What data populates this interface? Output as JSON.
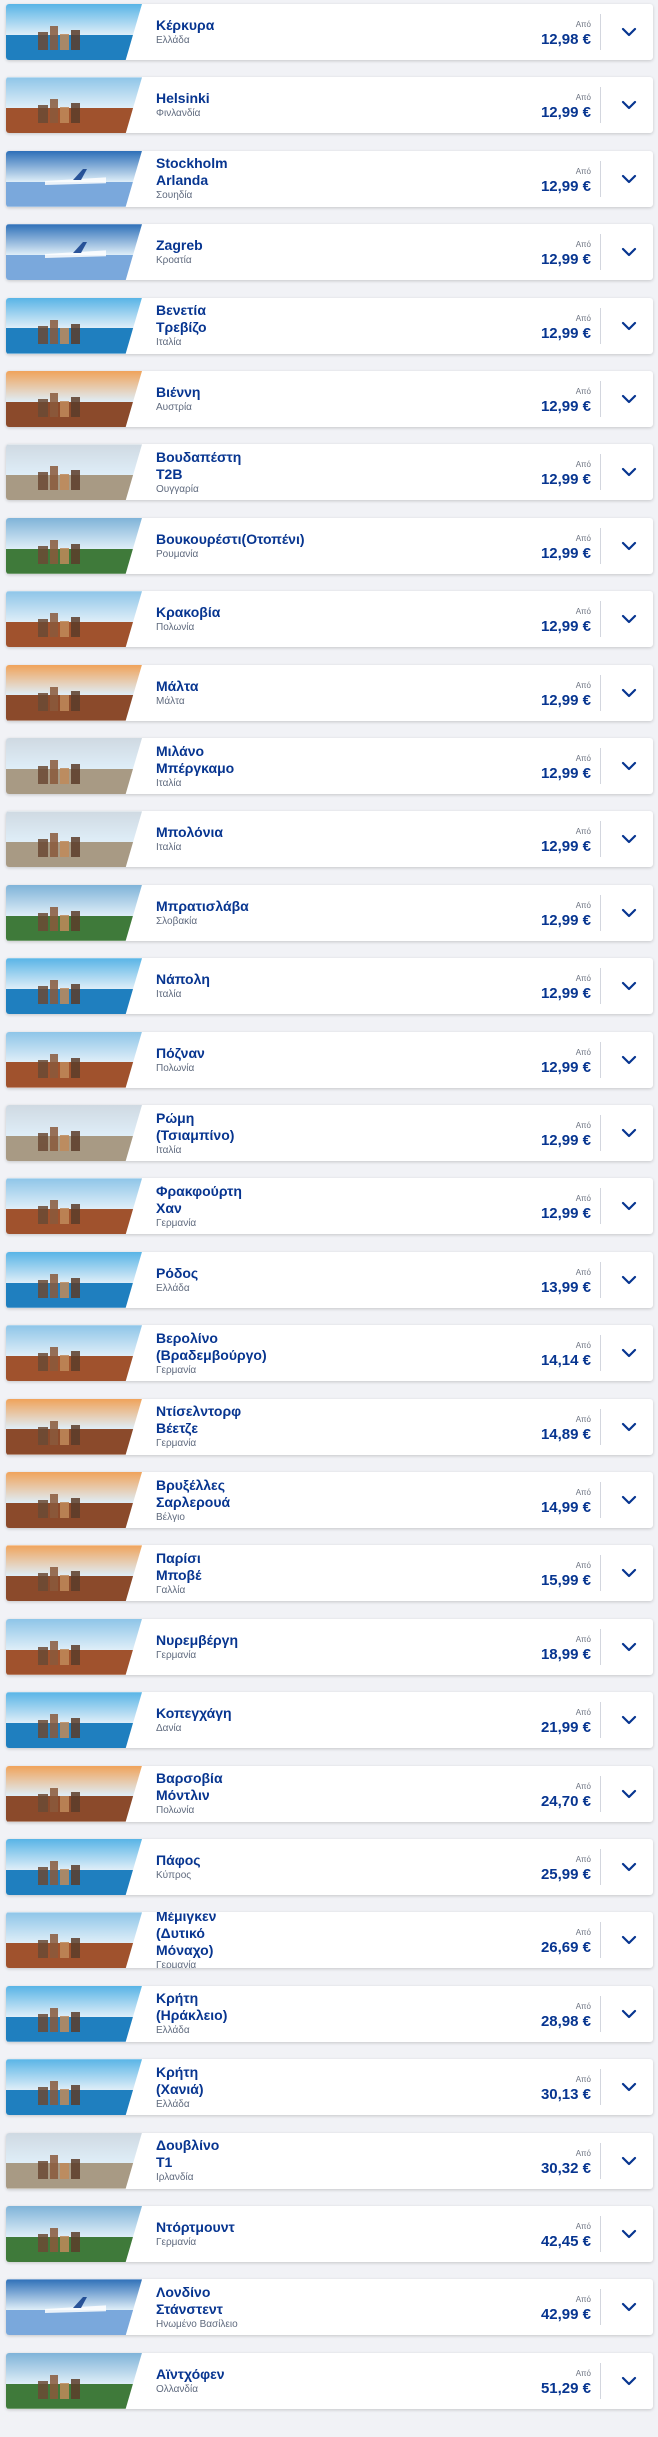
{
  "from_label": "Από",
  "destinations": [
    {
      "city": "Κέρκυρα",
      "country": "Ελλάδα",
      "price": "12,98 €",
      "theme": "sea"
    },
    {
      "city": "Helsinki",
      "country": "Φινλανδία",
      "price": "12,99 €",
      "theme": "city"
    },
    {
      "city": "Stockholm\nArlanda",
      "country": "Σουηδία",
      "price": "12,99 €",
      "theme": "plane"
    },
    {
      "city": "Zagreb",
      "country": "Κροατία",
      "price": "12,99 €",
      "theme": "plane"
    },
    {
      "city": "Βενετία\nΤρεβίζο",
      "country": "Ιταλία",
      "price": "12,99 €",
      "theme": "sea"
    },
    {
      "city": "Βιέννη",
      "country": "Αυστρία",
      "price": "12,99 €",
      "theme": "sunset"
    },
    {
      "city": "Βουδαπέστη\nT2B",
      "country": "Ουγγαρία",
      "price": "12,99 €",
      "theme": "stone"
    },
    {
      "city": "Βουκουρέστι(Οτοπένι)",
      "country": "Ρουμανία",
      "price": "12,99 €",
      "theme": "green"
    },
    {
      "city": "Κρακοβία",
      "country": "Πολωνία",
      "price": "12,99 €",
      "theme": "city"
    },
    {
      "city": "Μάλτα",
      "country": "Μάλτα",
      "price": "12,99 €",
      "theme": "sunset"
    },
    {
      "city": "Μιλάνο\nΜπέργκαμο",
      "country": "Ιταλία",
      "price": "12,99 €",
      "theme": "stone"
    },
    {
      "city": "Μπολόνια",
      "country": "Ιταλία",
      "price": "12,99 €",
      "theme": "stone"
    },
    {
      "city": "Μπρατισλάβα",
      "country": "Σλοβακία",
      "price": "12,99 €",
      "theme": "green"
    },
    {
      "city": "Νάπολη",
      "country": "Ιταλία",
      "price": "12,99 €",
      "theme": "sea"
    },
    {
      "city": "Πόζναν",
      "country": "Πολωνία",
      "price": "12,99 €",
      "theme": "city"
    },
    {
      "city": "Ρώμη\n(Τσιαμπίνο)",
      "country": "Ιταλία",
      "price": "12,99 €",
      "theme": "stone"
    },
    {
      "city": "Φρακφούρτη\nΧαν",
      "country": "Γερμανία",
      "price": "12,99 €",
      "theme": "city"
    },
    {
      "city": "Ρόδος",
      "country": "Ελλάδα",
      "price": "13,99 €",
      "theme": "sea"
    },
    {
      "city": "Βερολίνο\n(Βραδεμβούργο)",
      "country": "Γερμανία",
      "price": "14,14 €",
      "theme": "city"
    },
    {
      "city": "Ντίσελντορφ\nΒέετζε",
      "country": "Γερμανία",
      "price": "14,89 €",
      "theme": "sunset"
    },
    {
      "city": "Βρυξέλλες\nΣαρλερουά",
      "country": "Βέλγιο",
      "price": "14,99 €",
      "theme": "sunset"
    },
    {
      "city": "Παρίσι\nΜποβέ",
      "country": "Γαλλία",
      "price": "15,99 €",
      "theme": "sunset"
    },
    {
      "city": "Νυρεμβέργη",
      "country": "Γερμανία",
      "price": "18,99 €",
      "theme": "city"
    },
    {
      "city": "Κοπεγχάγη",
      "country": "Δανία",
      "price": "21,99 €",
      "theme": "sea"
    },
    {
      "city": "Βαρσοβία\nΜόντλιν",
      "country": "Πολωνία",
      "price": "24,70 €",
      "theme": "sunset"
    },
    {
      "city": "Πάφος",
      "country": "Κύπρος",
      "price": "25,99 €",
      "theme": "sea"
    },
    {
      "city": "Μέμιγκεν\n(Δυτικό\nΜόναχο)",
      "country": "Γερμανία",
      "price": "26,69 €",
      "theme": "city"
    },
    {
      "city": "Κρήτη\n(Ηράκλειο)",
      "country": "Ελλάδα",
      "price": "28,98 €",
      "theme": "sea"
    },
    {
      "city": "Κρήτη\n(Χανιά)",
      "country": "Ελλάδα",
      "price": "30,13 €",
      "theme": "sea"
    },
    {
      "city": "Δουβλίνο\nT1",
      "country": "Ιρλανδία",
      "price": "30,32 €",
      "theme": "stone"
    },
    {
      "city": "Ντόρτμουντ",
      "country": "Γερμανία",
      "price": "42,45 €",
      "theme": "green"
    },
    {
      "city": "Λονδίνο\nΣτάνστεντ",
      "country": "Ηνωμένο\nΒασίλειο",
      "price": "42,99 €",
      "theme": "plane"
    },
    {
      "city": "Αϊντχόφεν",
      "country": "Ολλανδία",
      "price": "51,29 €",
      "theme": "green"
    }
  ],
  "colors": {
    "brand": "#073590",
    "background": "#f1f2f6",
    "card": "#ffffff"
  }
}
